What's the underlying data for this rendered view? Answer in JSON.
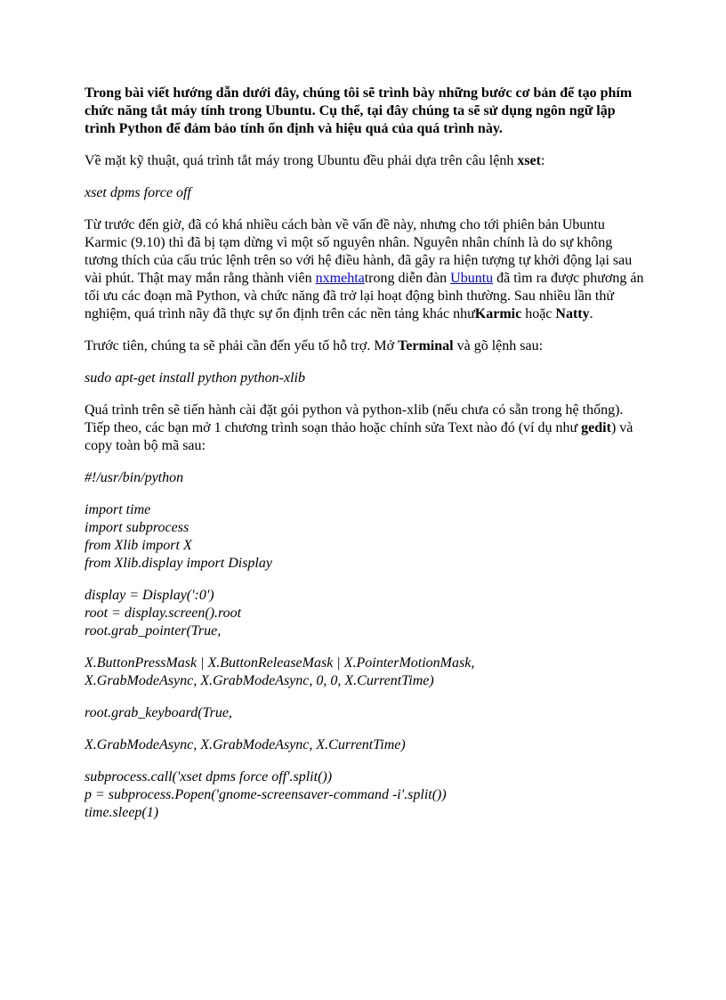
{
  "intro": "Trong bài viết hướng dẫn dưới đây, chúng tôi sẽ trình bày những bước cơ bản để tạo phím chức năng tắt máy tính trong Ubuntu. Cụ thể, tại đây chúng ta sẽ sử dụng ngôn ngữ lập trình Python để đảm bảo tính ổn định và hiệu quả của quá trình này.",
  "p2_pre": "Về mặt kỹ thuật, quá trình tắt máy trong Ubuntu đều phải dựa trên câu lệnh ",
  "p2_cmd": "xset",
  "p2_post": ":",
  "cmd1": "xset dpms force off",
  "p3_a": "Từ trước đến giờ, đã có khá nhiều cách bàn về vấn đề này, nhưng cho tới phiên bản Ubuntu Karmic (9.10) thì đã bị tạm dừng vì một số nguyên nhân. Nguyên nhân chính là do sự không tương thích của cấu trúc lệnh trên so với hệ điều hành, đã gây ra hiện tượng tự khởi động lại sau vài phút. Thật may mắn rằng thành viên ",
  "link1": "nxmehta",
  "p3_b": "trong diễn đàn ",
  "link2": "Ubuntu",
  "p3_c": " đã tìm ra được phương án tối ưu các đoạn mã Python, và chức năng đã trở lại hoạt động bình thường. Sau nhiều lần thử nghiệm, quá trình nãy đã thực sự ổn định trên các nền tảng khác như",
  "p3_k": "Karmic",
  "p3_or": " hoặc ",
  "p3_n": "Natty",
  "p3_end": ".",
  "p4_a": "Trước tiên, chúng ta sẽ phải cần đến yếu tố hỗ trợ. Mở ",
  "p4_term": "Terminal",
  "p4_b": " và gõ lệnh sau:",
  "cmd2": "sudo apt-get install python python-xlib",
  "p5_a": "Quá trình trên sẽ tiến hành cài đặt gói python và python-xlib (nếu chưa có sẵn trong hệ thống). Tiếp theo, các bạn mở 1 chương trình soạn thảo hoặc chỉnh sửa Text nào đó (ví dụ như ",
  "p5_g": "gedit",
  "p5_b": ") và copy toàn bộ mã sau:",
  "code": {
    "l1": "#!/usr/bin/python",
    "l2": "import time",
    "l3": "import subprocess",
    "l4": "from Xlib import X",
    "l5": "from Xlib.display import Display",
    "l6": "display = Display(':0')",
    "l7": "root = display.screen().root",
    "l8": "root.grab_pointer(True,",
    "l9": "X.ButtonPressMask | X.ButtonReleaseMask | X.PointerMotionMask,",
    "l10": "X.GrabModeAsync, X.GrabModeAsync, 0, 0, X.CurrentTime)",
    "l11": "root.grab_keyboard(True,",
    "l12": "X.GrabModeAsync, X.GrabModeAsync, X.CurrentTime)",
    "l13": "subprocess.call('xset dpms force off'.split())",
    "l14": "p = subprocess.Popen('gnome-screensaver-command -i'.split())",
    "l15": "time.sleep(1)"
  }
}
